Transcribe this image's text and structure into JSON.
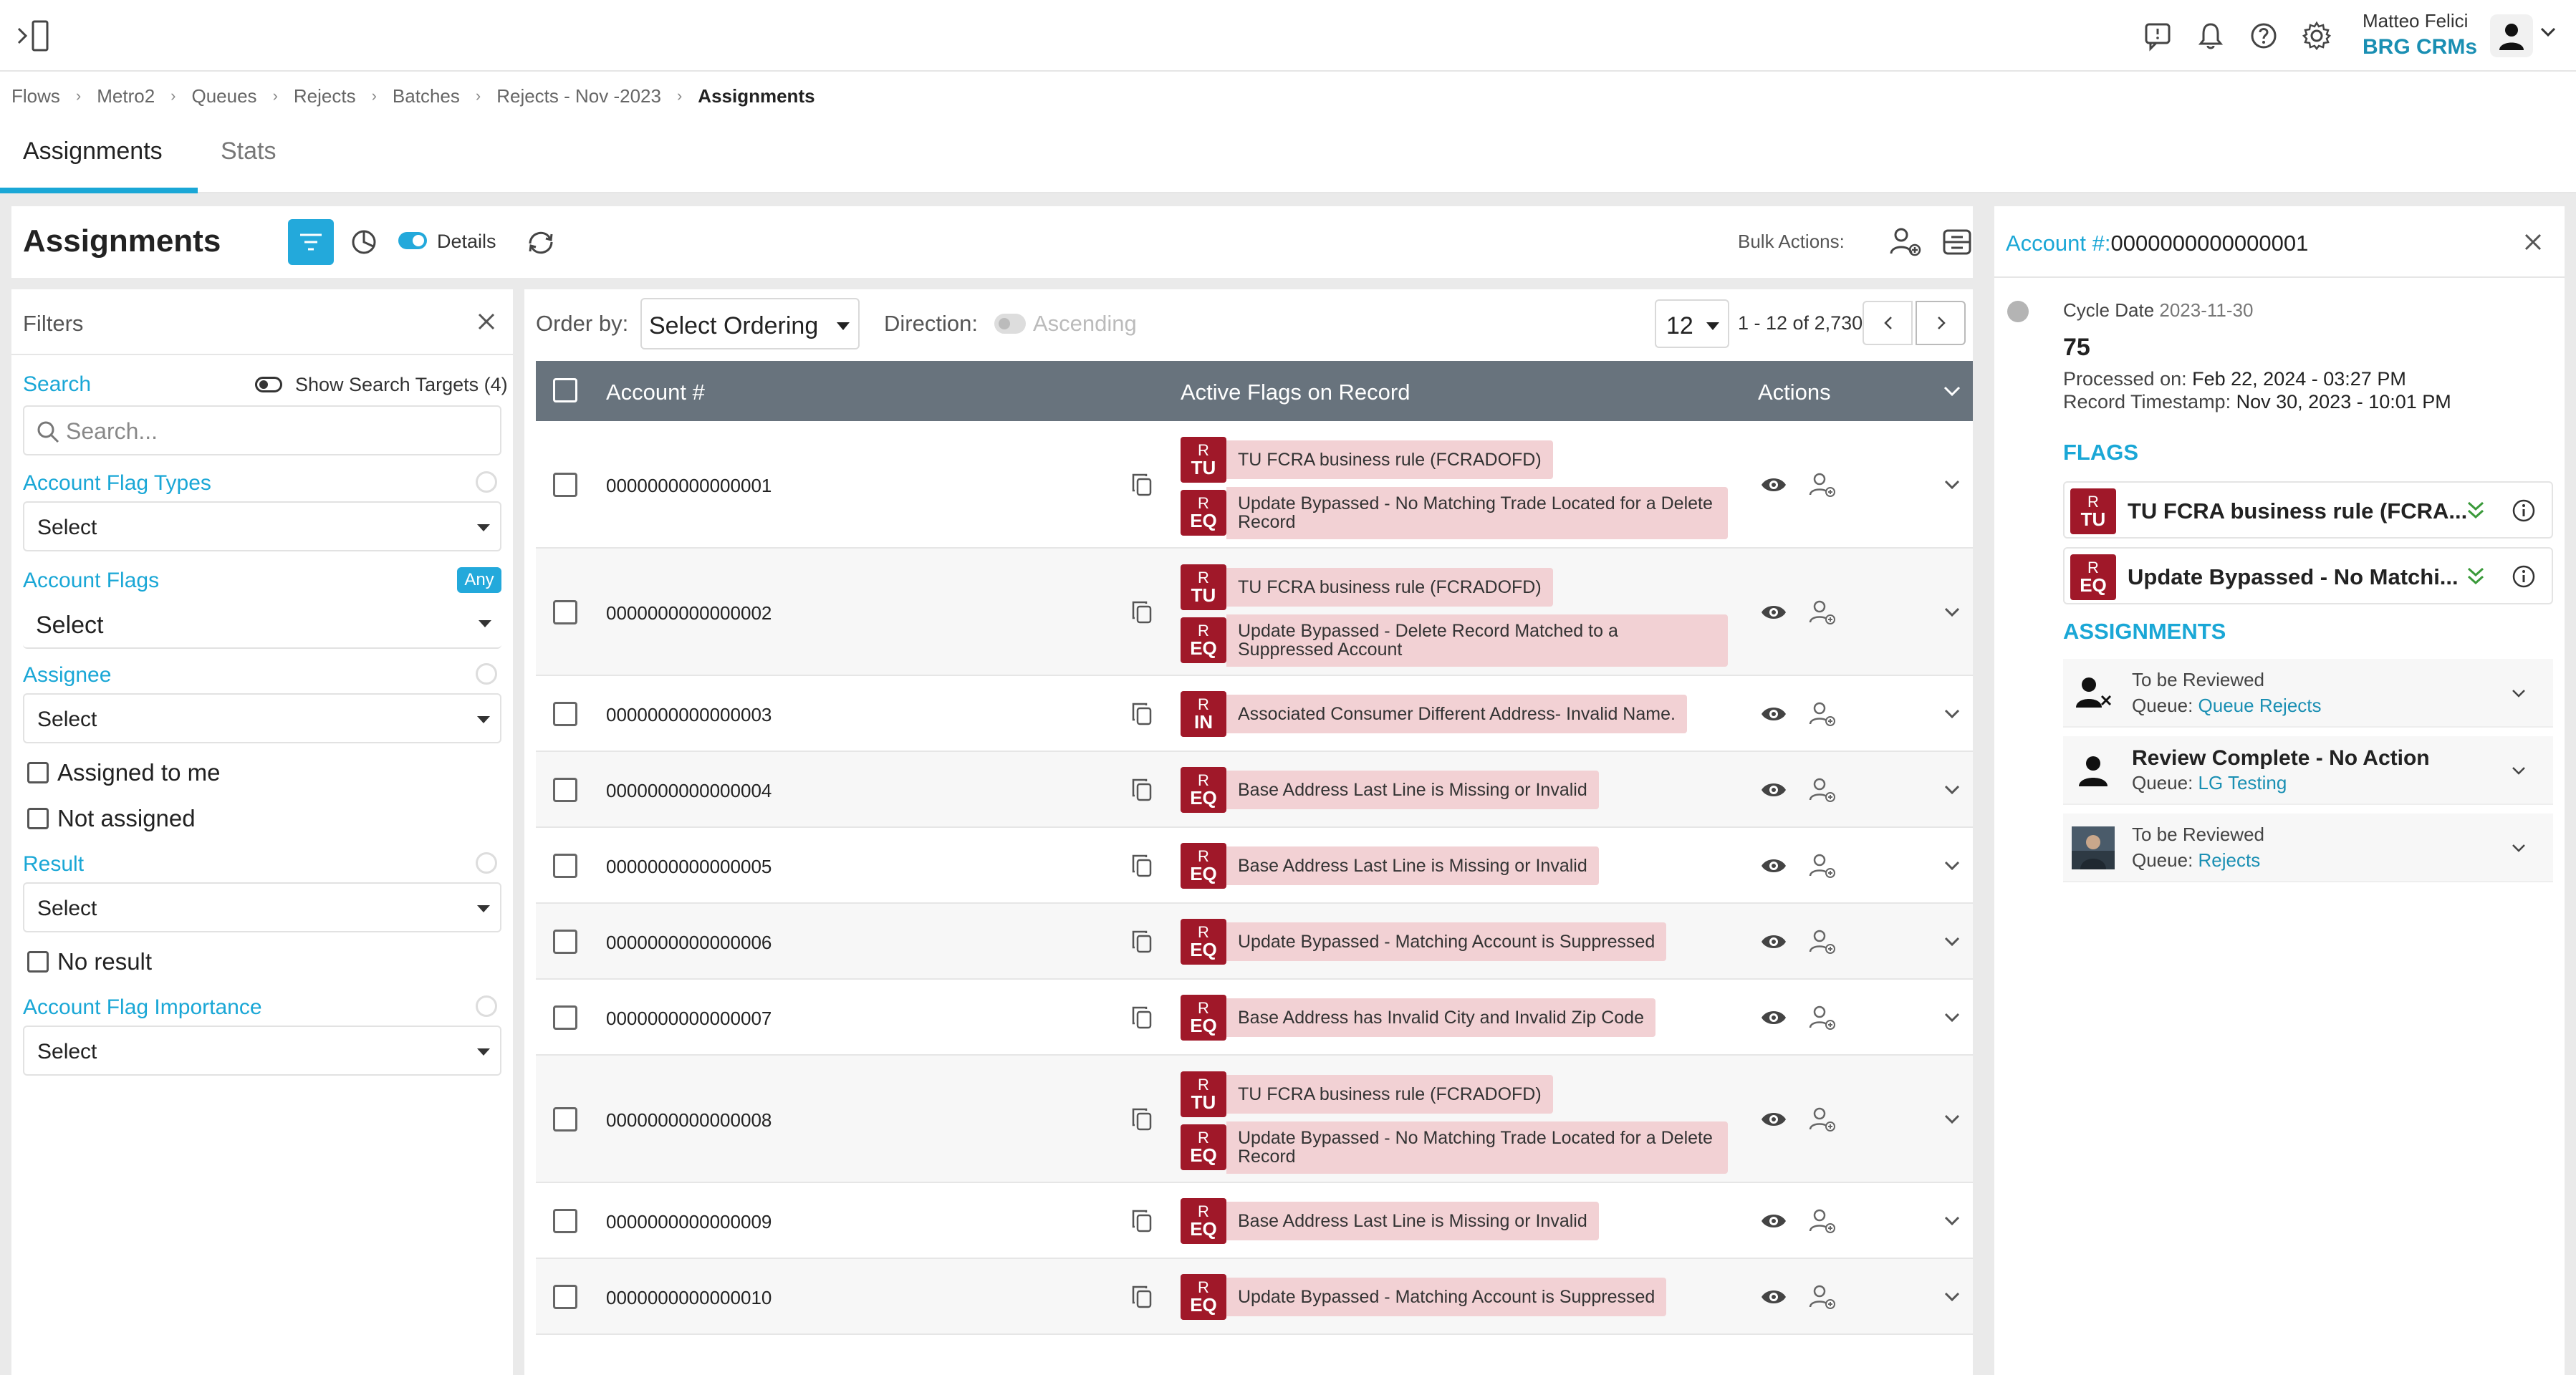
{
  "header": {
    "user_name": "Matteo Felici",
    "org_name": "BRG CRMs"
  },
  "breadcrumb": {
    "items": [
      "Flows",
      "Metro2",
      "Queues",
      "Rejects",
      "Batches",
      "Rejects - Nov -2023"
    ],
    "current": "Assignments"
  },
  "tabs": [
    {
      "label": "Assignments",
      "active": true
    },
    {
      "label": "Stats",
      "active": false
    }
  ],
  "toolbar": {
    "title": "Assignments",
    "details_label": "Details",
    "details_on": true,
    "bulk_label": "Bulk Actions:"
  },
  "filters": {
    "title": "Filters",
    "search_label": "Search",
    "show_targets_label": "Show Search Targets (4)",
    "search_placeholder": "Search...",
    "flag_types_label": "Account Flag Types",
    "flag_types_value": "Select",
    "flags_label": "Account Flags",
    "flags_badge": "Any",
    "flags_value": "Select",
    "assignee_label": "Assignee",
    "assignee_value": "Select",
    "assigned_to_me": "Assigned to me",
    "not_assigned": "Not assigned",
    "result_label": "Result",
    "result_value": "Select",
    "no_result": "No result",
    "importance_label": "Account Flag Importance",
    "importance_value": "Select"
  },
  "table_controls": {
    "order_by_label": "Order by:",
    "order_by_value": "Select Ordering",
    "direction_label": "Direction:",
    "direction_value": "Ascending",
    "page_size": "12",
    "range": "1 - 12 of 2,730"
  },
  "table": {
    "columns": [
      "Account #",
      "Active Flags on Record",
      "Actions"
    ],
    "rows": [
      {
        "account": "0000000000000001",
        "flags": [
          {
            "c1": "R",
            "c2": "TU",
            "text": "TU FCRA business rule (FCRADOFD)"
          },
          {
            "c1": "R",
            "c2": "EQ",
            "text": "Update Bypassed - No Matching Trade Located for a Delete Record"
          }
        ]
      },
      {
        "account": "0000000000000002",
        "flags": [
          {
            "c1": "R",
            "c2": "TU",
            "text": "TU FCRA business rule (FCRADOFD)"
          },
          {
            "c1": "R",
            "c2": "EQ",
            "text": "Update Bypassed - Delete Record Matched to a Suppressed Account"
          }
        ]
      },
      {
        "account": "0000000000000003",
        "flags": [
          {
            "c1": "R",
            "c2": "IN",
            "text": "Associated Consumer Different Address- Invalid Name."
          }
        ]
      },
      {
        "account": "0000000000000004",
        "flags": [
          {
            "c1": "R",
            "c2": "EQ",
            "text": "Base Address Last Line is Missing or Invalid"
          }
        ]
      },
      {
        "account": "0000000000000005",
        "flags": [
          {
            "c1": "R",
            "c2": "EQ",
            "text": "Base Address Last Line is Missing or Invalid"
          }
        ]
      },
      {
        "account": "0000000000000006",
        "flags": [
          {
            "c1": "R",
            "c2": "EQ",
            "text": "Update Bypassed - Matching Account is Suppressed"
          }
        ]
      },
      {
        "account": "0000000000000007",
        "flags": [
          {
            "c1": "R",
            "c2": "EQ",
            "text": "Base Address has Invalid City and Invalid Zip Code"
          }
        ]
      },
      {
        "account": "0000000000000008",
        "flags": [
          {
            "c1": "R",
            "c2": "TU",
            "text": "TU FCRA business rule (FCRADOFD)"
          },
          {
            "c1": "R",
            "c2": "EQ",
            "text": "Update Bypassed - No Matching Trade Located for a Delete Record"
          }
        ]
      },
      {
        "account": "0000000000000009",
        "flags": [
          {
            "c1": "R",
            "c2": "EQ",
            "text": "Base Address Last Line is Missing or Invalid"
          }
        ]
      },
      {
        "account": "0000000000000010",
        "flags": [
          {
            "c1": "R",
            "c2": "EQ",
            "text": "Update Bypassed - Matching Account is Suppressed"
          }
        ]
      }
    ]
  },
  "detail": {
    "account_label": "Account #:",
    "account_value": "0000000000000001",
    "cycle_label": "Cycle Date",
    "cycle_value": "2023-11-30",
    "number": "75",
    "processed_label": "Processed on:",
    "processed_value": "Feb 22, 2024 - 03:27 PM",
    "timestamp_label": "Record Timestamp:",
    "timestamp_value": "Nov 30, 2023 - 10:01 PM",
    "flags_head": "FLAGS",
    "flags": [
      {
        "c1": "R",
        "c2": "TU",
        "text": "TU FCRA business rule (FCRA..."
      },
      {
        "c1": "R",
        "c2": "EQ",
        "text": "Update Bypassed - No Matchi..."
      }
    ],
    "assignments_head": "ASSIGNMENTS",
    "assignments": [
      {
        "status": "To be Reviewed",
        "queue_label": "Queue:",
        "queue": "Queue Rejects",
        "avatar": "user-x-icon"
      },
      {
        "status": "Review Complete - No Action",
        "queue_label": "Queue:",
        "queue": "LG Testing",
        "avatar": "user-icon"
      },
      {
        "status": "To be Reviewed",
        "queue_label": "Queue:",
        "queue": "Rejects",
        "avatar": "photo-avatar"
      }
    ]
  },
  "colors": {
    "accent": "#1aa7d6",
    "flag_code_bg": "#a01829",
    "flag_text_bg": "#f2d1d4",
    "table_header": "#68737d"
  }
}
